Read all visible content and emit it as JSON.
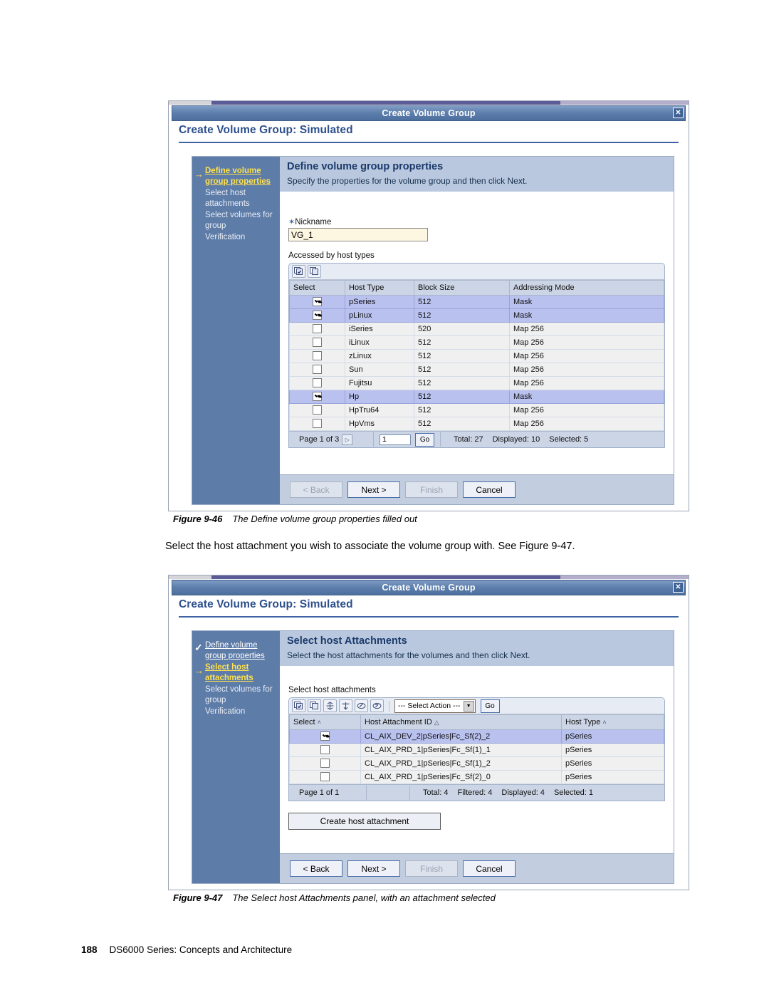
{
  "document": {
    "footer_page_number": "188",
    "footer_title": "DS6000 Series: Concepts and Architecture",
    "paragraph": "Select the host attachment you wish to associate the volume group with. See Figure 9-47.",
    "caption1_number": "Figure 9-46",
    "caption1_text": "The Define volume group properties filled out",
    "caption2_number": "Figure 9-47",
    "caption2_text": "The Select host Attachments panel, with an attachment selected"
  },
  "colors": {
    "titlebar": "#4d6f9e",
    "nav_panel": "#5d7ca8",
    "section_header": "#b9c8de",
    "current_step": "#ffe14d",
    "selected_row": "#b9c1ef",
    "button_bar": "#c2cee0",
    "link_blue": "#2c4f8c"
  },
  "fig1": {
    "window_title": "Create Volume Group",
    "close_label": "✕",
    "page_header": "Create Volume Group: Simulated",
    "nav": [
      {
        "label": "Define volume group properties",
        "state": "current",
        "marker": "→"
      },
      {
        "label": "Select host attachments",
        "state": "pending",
        "marker": ""
      },
      {
        "label": "Select volumes for group",
        "state": "pending",
        "marker": ""
      },
      {
        "label": "Verification",
        "state": "pending",
        "marker": ""
      }
    ],
    "section_title": "Define volume group properties",
    "section_subtitle": "Specify the properties for the volume group and then click Next.",
    "nickname_required_mark": "✶",
    "nickname_label": "Nickname",
    "nickname_value": "VG_1",
    "nickname_placeholder": "",
    "table_label": "Accessed by host types",
    "toolbar_icons": [
      "select-all-icon",
      "deselect-all-icon"
    ],
    "table": {
      "columns": [
        "Select",
        "Host Type",
        "Block Size",
        "Addressing Mode"
      ],
      "rows": [
        {
          "checked": true,
          "host_type": "pSeries",
          "block_size": "512",
          "addressing_mode": "Mask",
          "selected": true
        },
        {
          "checked": true,
          "host_type": "pLinux",
          "block_size": "512",
          "addressing_mode": "Mask",
          "selected": true
        },
        {
          "checked": false,
          "host_type": "iSeries",
          "block_size": "520",
          "addressing_mode": "Map 256",
          "selected": false
        },
        {
          "checked": false,
          "host_type": "iLinux",
          "block_size": "512",
          "addressing_mode": "Map 256",
          "selected": false
        },
        {
          "checked": false,
          "host_type": "zLinux",
          "block_size": "512",
          "addressing_mode": "Map 256",
          "selected": false
        },
        {
          "checked": false,
          "host_type": "Sun",
          "block_size": "512",
          "addressing_mode": "Map 256",
          "selected": false
        },
        {
          "checked": false,
          "host_type": "Fujitsu",
          "block_size": "512",
          "addressing_mode": "Map 256",
          "selected": false
        },
        {
          "checked": true,
          "host_type": "Hp",
          "block_size": "512",
          "addressing_mode": "Mask",
          "selected": true
        },
        {
          "checked": false,
          "host_type": "HpTru64",
          "block_size": "512",
          "addressing_mode": "Map 256",
          "selected": false
        },
        {
          "checked": false,
          "host_type": "HpVms",
          "block_size": "512",
          "addressing_mode": "Map 256",
          "selected": false
        }
      ]
    },
    "footer": {
      "page_label": "Page 1 of 3",
      "next_page_arrow": "▷",
      "page_input_value": "1",
      "go_label": "Go",
      "total": "Total: 27",
      "displayed": "Displayed: 10",
      "selected": "Selected: 5"
    },
    "buttons": [
      {
        "label": "< Back",
        "enabled": false
      },
      {
        "label": "Next >",
        "enabled": true
      },
      {
        "label": "Finish",
        "enabled": false
      },
      {
        "label": "Cancel",
        "enabled": true
      }
    ]
  },
  "fig2": {
    "window_title": "Create Volume Group",
    "close_label": "✕",
    "page_header": "Create Volume Group: Simulated",
    "nav": [
      {
        "label": "Define volume group properties",
        "state": "done",
        "marker": "✓"
      },
      {
        "label": "Select host attachments",
        "state": "current",
        "marker": "→"
      },
      {
        "label": "Select volumes for group",
        "state": "pending",
        "marker": ""
      },
      {
        "label": "Verification",
        "state": "pending",
        "marker": ""
      }
    ],
    "section_title": "Select host Attachments",
    "section_subtitle": "Select the host attachments for the volumes and then click Next.",
    "table_label": "Select host attachments",
    "toolbar_icons": [
      "select-all-icon",
      "deselect-all-icon",
      "expand-all-icon",
      "collapse-all-icon",
      "edit-sort-icon",
      "clear-sort-icon"
    ],
    "action_select_value": "--- Select Action ---",
    "action_go_label": "Go",
    "table": {
      "columns": [
        "Select",
        "Host Attachment ID",
        "Host Type"
      ],
      "sort_markers": [
        "˄",
        "△",
        "˄"
      ],
      "rows": [
        {
          "checked": true,
          "attachment_id": "CL_AIX_DEV_2|pSeries|Fc_Sf(2)_2",
          "host_type": "pSeries",
          "selected": true
        },
        {
          "checked": false,
          "attachment_id": "CL_AIX_PRD_1|pSeries|Fc_Sf(1)_1",
          "host_type": "pSeries",
          "selected": false
        },
        {
          "checked": false,
          "attachment_id": "CL_AIX_PRD_1|pSeries|Fc_Sf(1)_2",
          "host_type": "pSeries",
          "selected": false
        },
        {
          "checked": false,
          "attachment_id": "CL_AIX_PRD_1|pSeries|Fc_Sf(2)_0",
          "host_type": "pSeries",
          "selected": false
        }
      ]
    },
    "footer": {
      "page_label": "Page 1 of 1",
      "total": "Total: 4",
      "filtered": "Filtered: 4",
      "displayed": "Displayed: 4",
      "selected": "Selected: 1"
    },
    "create_attachment_label": "Create host attachment",
    "buttons": [
      {
        "label": "< Back",
        "enabled": true
      },
      {
        "label": "Next >",
        "enabled": true
      },
      {
        "label": "Finish",
        "enabled": false
      },
      {
        "label": "Cancel",
        "enabled": true
      }
    ]
  }
}
